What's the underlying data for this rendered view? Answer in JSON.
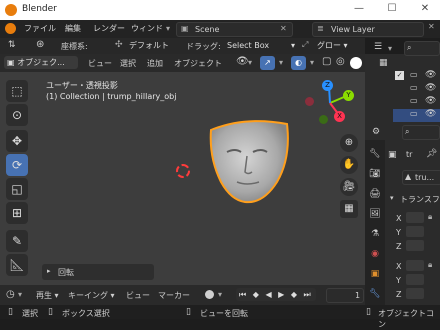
{
  "window": {
    "title": "Blender",
    "min_icon": "minimize-icon",
    "max_icon": "maximize-icon",
    "close_icon": "close-icon"
  },
  "menu": {
    "items": [
      "ファイル",
      "編集",
      "レンダー",
      "ウィンド"
    ],
    "scene": "Scene",
    "view_layer": "View Layer"
  },
  "toolbar": {
    "coord_label": "座標系:",
    "coord_value": "デフォルト",
    "drag_label": "ドラッグ:",
    "drag_value": "Select Box",
    "global_value": "グロー"
  },
  "header": {
    "mode": "オブジェク...",
    "view": "ビュー",
    "select": "選択",
    "add": "追加",
    "object": "オブジェクト"
  },
  "viewport": {
    "view_name": "ユーザー・透視投影",
    "collection": "(1) Collection | trump_hillary_obj",
    "last_op": "回転"
  },
  "gizmo": {
    "x": "X",
    "y": "Y",
    "z": "Z"
  },
  "properties": {
    "name_field": "tr",
    "object_field": "tru...",
    "transform": "トランスフ",
    "axes": [
      "X",
      "Y",
      "Z",
      "X",
      "Y",
      "Z"
    ]
  },
  "timeline": {
    "playback": "再生",
    "keying": "キーイング",
    "view": "ビュー",
    "marker": "マーカー",
    "frame": "1"
  },
  "status": {
    "select": "選択",
    "box_select": "ボックス選択",
    "rotate_view": "ビューを回転",
    "object_context": "オブジェクトコン"
  },
  "colors": {
    "accent": "#4772b3",
    "selection_outline": "#ff9f1c",
    "x_axis": "#ff3352",
    "y_axis": "#8bdc00",
    "z_axis": "#2890ff"
  }
}
